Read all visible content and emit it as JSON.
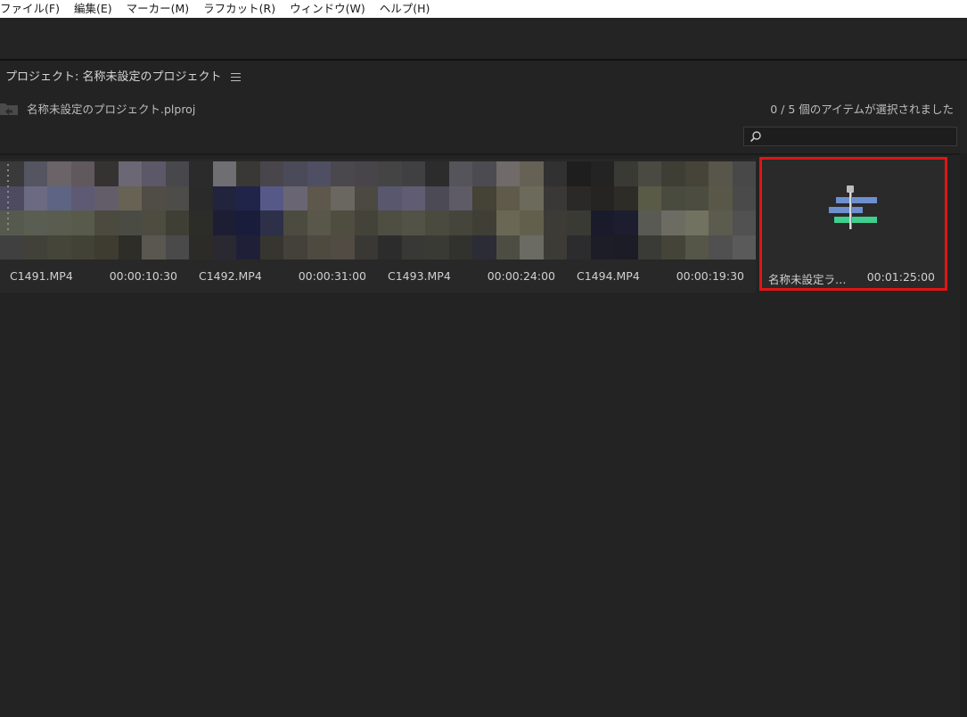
{
  "menubar": {
    "items": [
      "ファイル(F)",
      "編集(E)",
      "マーカー(M)",
      "ラフカット(R)",
      "ウィンドウ(W)",
      "ヘルプ(H)"
    ]
  },
  "panel": {
    "title": "プロジェクト: 名称未設定のプロジェクト",
    "menu_icon": "hamburger-menu-icon",
    "project_file": "名称未設定のプロジェクト.plproj",
    "selection_status": "0 / 5 個のアイテムが選択されました",
    "search": {
      "value": "",
      "placeholder": ""
    }
  },
  "clips": [
    {
      "name": "C1491.MP4",
      "duration": "00:00:10:30",
      "colors": [
        "#3a3a3a",
        "#555461",
        "#6a6468",
        "#60585c",
        "#343332",
        "#6b6775",
        "#5c5868",
        "#48474c",
        "#4e4a60",
        "#6c6a83",
        "#5e6484",
        "#5e5a74",
        "#635d6a",
        "#686255",
        "#504c46",
        "#4e4c48",
        "#565a4e",
        "#5a5d52",
        "#5a5c50",
        "#585a4c",
        "#4b4a3e",
        "#4a4b42",
        "#4c4c40",
        "#403f35",
        "#404040",
        "#414139",
        "#454639",
        "#434236",
        "#3e3c31",
        "#2e2d28",
        "#5a5750",
        "#4a4a4a"
      ]
    },
    {
      "name": "C1492.MP4",
      "duration": "00:00:31:00",
      "colors": [
        "#2b2b2b",
        "#6f6e72",
        "#3a3834",
        "#48464b",
        "#4a4a58",
        "#4f4f63",
        "#4a474d",
        "#48454a",
        "#2a2a2a",
        "#22233d",
        "#202448",
        "#565987",
        "#6a6572",
        "#5d574c",
        "#6a6760",
        "#4b4940",
        "#2c2c28",
        "#1d1e33",
        "#1a1c3c",
        "#2d3048",
        "#4c4b40",
        "#585749",
        "#4f4d3f",
        "#44433a",
        "#2c2b28",
        "#2a2932",
        "#1f2038",
        "#36352f",
        "#44413a",
        "#4e4a40",
        "#514b44",
        "#3a3834"
      ]
    },
    {
      "name": "C1493.MP4",
      "duration": "00:00:24:00",
      "colors": [
        "#444444",
        "#404043",
        "#2c2c2c",
        "#55545a",
        "#4c4b52",
        "#706a68",
        "#666155",
        "#313131",
        "#58576e",
        "#605d72",
        "#4b4a55",
        "#5e5b66",
        "#454236",
        "#5f5a4a",
        "#6c6a5a",
        "#3a3836",
        "#4e4e43",
        "#525246",
        "#4a4a3e",
        "#45453b",
        "#403f36",
        "#6a6854",
        "#62604c",
        "#3c3b36",
        "#2c2c2c",
        "#383834",
        "#3a3a35",
        "#31312e",
        "#2b2c35",
        "#4e4d44",
        "#6b6a63",
        "#3c3b35"
      ]
    },
    {
      "name": "C1494.MP4",
      "duration": "00:00:19:30",
      "colors": [
        "#1e1e1e",
        "#232323",
        "#3a3a34",
        "#4b4a42",
        "#3f3e35",
        "#464438",
        "#58564a",
        "#484848",
        "#2a2927",
        "#262422",
        "#2d2c26",
        "#595b46",
        "#4a4b3f",
        "#4c4c40",
        "#585748",
        "#4a4a4a",
        "#3a3a35",
        "#1a1b2a",
        "#1c1d2e",
        "#5a5a55",
        "#6c6c63",
        "#727260",
        "#5b5b4e",
        "#515151",
        "#2c2c2e",
        "#1d1d28",
        "#1c1c26",
        "#3a3a36",
        "#444438",
        "#555548",
        "#505050",
        "#5a5a5a"
      ]
    }
  ],
  "sequence": {
    "name": "名称未設定ラ…",
    "duration": "00:01:25:00",
    "icon": "sequence-timeline-icon",
    "icon_colors": {
      "pin": "#bdbdbd",
      "top": "#6e8fd0",
      "middle": "#6e8fd0",
      "bottom": "#3fcf8e",
      "line": "#d8d8d8"
    },
    "highlight_color": "#e01515"
  }
}
